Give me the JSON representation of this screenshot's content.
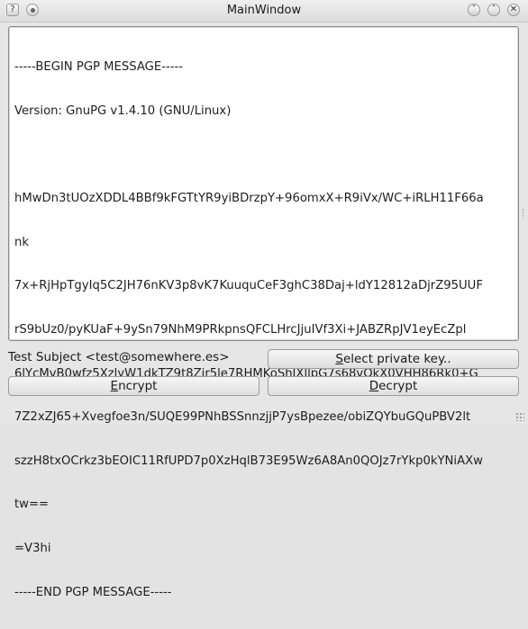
{
  "window": {
    "title": "MainWindow",
    "help_glyph": "?",
    "min_glyph": "˅",
    "max_glyph": "˄",
    "close_glyph": "✕"
  },
  "editor": {
    "lines": [
      "-----BEGIN PGP MESSAGE-----",
      "Version: GnuPG v1.4.10 (GNU/Linux)",
      "",
      "hMwDn3tUOzXDDL4BBf9kFGTtYR9yiBDrzpY+96omxX+R9iVx/WC+iRLH11F66a",
      "nk",
      "7x+RjHpTgyIq5C2JH76nKV3p8vK7KuuquCeF3ghC38Daj+ldY12812aDjrZ95UUF",
      "rS9bUz0/pyKUaF+9ySn79NhM9PRkpnsQFCLHrcJjuIVf3Xi+JABZRpJV1eyEcZpl",
      "6lYcMvB0wfz5XzlyW1dkTZ9t8Zir5le7RHMKoShJXllpG7s68vQkX0VHH86Rk0+G",
      "7Z2xZJ65+Xvegfoe3n/SUQE99PNhBSSnnzjjP7ysBpezee/obiZQYbuGQuPBV2lt",
      "szzH8txOCrkz3bEOIC11RfUPD7p0XzHqlB73E95Wz6A8An0QOJz7rYkp0kYNiAXw",
      "tw==",
      "=V3hi",
      "-----END PGP MESSAGE-----"
    ]
  },
  "subject": {
    "label": "Test Subject <test@somewhere.es>"
  },
  "buttons": {
    "select_key": {
      "mnemonic": "S",
      "rest": "elect private key.."
    },
    "encrypt": {
      "mnemonic": "E",
      "rest": "ncrypt"
    },
    "decrypt": {
      "mnemonic": "D",
      "rest": "ecrypt"
    }
  }
}
